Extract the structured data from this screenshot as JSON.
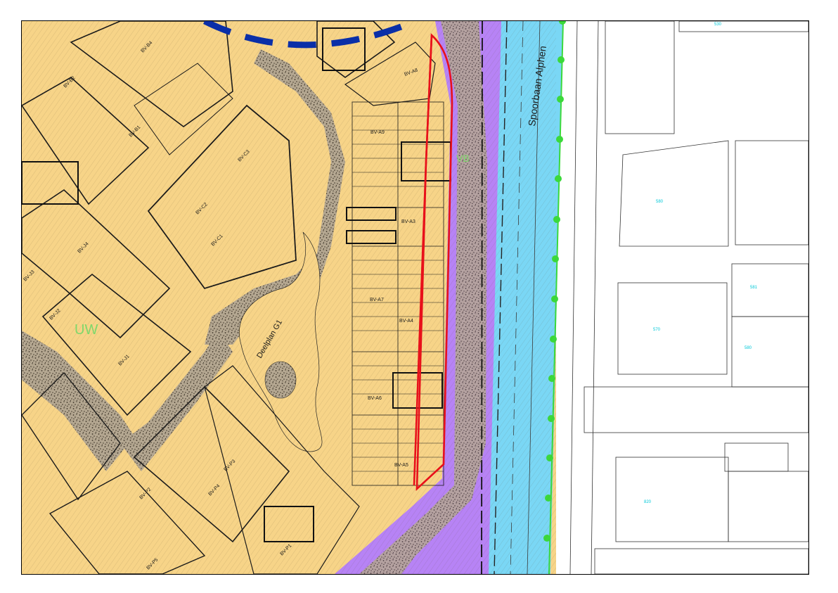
{
  "map": {
    "zone_code_large": "UW",
    "zone_code_rail": "VB",
    "railway_label": "Spoorbaan Alphen",
    "plan_area_label": "Deelplan G1",
    "block_labels": {
      "a8": "BV-A8",
      "a9": "BV-A9",
      "a3": "BV-A3",
      "a7": "BV-A7",
      "a4": "BV-A4",
      "a6": "BV-A6",
      "a5": "BV-A5",
      "b1": "BV-B1",
      "b2": "BV-B2",
      "b4": "BV-B4",
      "c1": "BV-C1",
      "c2": "BV-C2",
      "c3": "BV-C3",
      "j1": "BV-J1",
      "j2": "BV-J2",
      "j3": "BV-J3",
      "j4": "BV-J4",
      "p1": "BV-P1",
      "p2": "BV-P2",
      "p3": "BV-P3",
      "p4": "BV-P4",
      "p5": "BV-P5"
    },
    "parcel_numbers": {
      "n530": "530",
      "n580a": "580",
      "n581": "581",
      "n570": "570",
      "n580b": "580",
      "n820": "820"
    },
    "colors": {
      "residential": "#f7d488",
      "traffic": "#b783f5",
      "rail_water": "#7ad7f5",
      "green_verge": "#3bd93b",
      "boundary_red": "#e8101a",
      "dashed_blue": "#0a2fa8",
      "speckle": "#7a6a55"
    }
  }
}
